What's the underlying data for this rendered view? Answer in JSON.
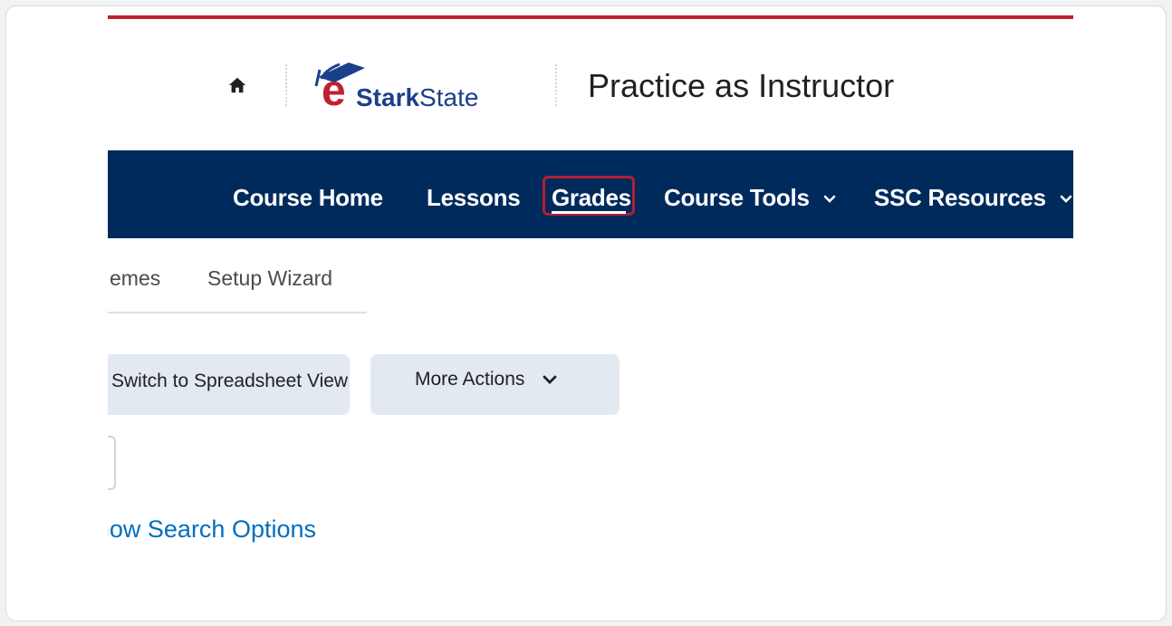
{
  "header": {
    "home_icon": "home-icon",
    "logo": {
      "prefix": "e",
      "bold": "Stark",
      "regular": "State",
      "accent": "#c0202d",
      "brand": "#1c3f8c"
    },
    "course_title": "Practice as Instructor"
  },
  "nav": {
    "items": [
      {
        "label": "Course Home"
      },
      {
        "label": "Lessons"
      },
      {
        "label": "Grades",
        "selected": true
      },
      {
        "label": "Course Tools",
        "dropdown": true
      },
      {
        "label": "SSC Resources",
        "dropdown": true
      }
    ],
    "background": "#002a5c",
    "highlight_color": "#b21f33"
  },
  "subtabs": {
    "items": [
      {
        "label": "emes"
      },
      {
        "label": "Setup Wizard"
      }
    ]
  },
  "actions": {
    "spreadsheet_label": "Switch to Spreadsheet View",
    "more_label": "More Actions"
  },
  "search": {
    "options_link": "Show Search Options"
  }
}
